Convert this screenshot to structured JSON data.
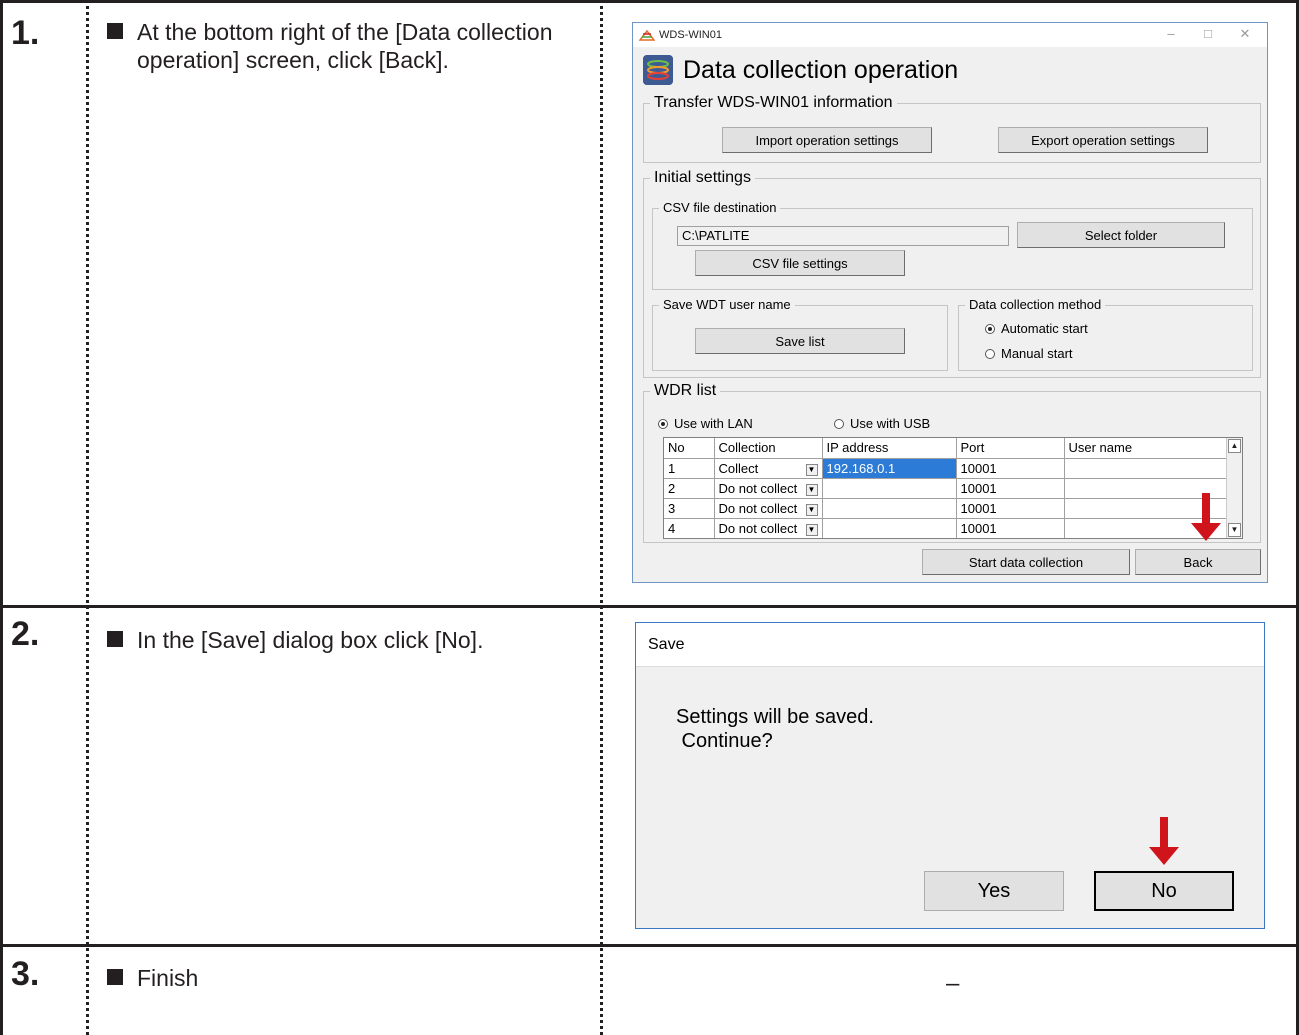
{
  "steps": [
    {
      "number": "1.",
      "text": "At the bottom right of the [Data collection operation] screen, click [Back]."
    },
    {
      "number": "2.",
      "text": "In the [Save] dialog box click [No]."
    },
    {
      "number": "3.",
      "text": "Finish"
    }
  ],
  "step3_result": "–",
  "app_window": {
    "window_title": "WDS-WIN01",
    "heading": "Data collection operation",
    "transfer_group": {
      "label": "Transfer WDS-WIN01 information",
      "import_label": "Import operation settings",
      "export_label": "Export operation settings"
    },
    "initial_group": {
      "label": "Initial settings",
      "csv_group_label": "CSV file destination",
      "csv_path": "C:\\PATLITE",
      "select_folder_label": "Select folder",
      "csv_settings_label": "CSV file settings",
      "save_user_group_label": "Save WDT user name",
      "save_list_label": "Save list",
      "method_group_label": "Data collection method",
      "method_options": [
        {
          "label": "Automatic start",
          "selected": true
        },
        {
          "label": "Manual start",
          "selected": false
        }
      ]
    },
    "wdr_group": {
      "label": "WDR list",
      "interface_options": [
        {
          "label": "Use with LAN",
          "selected": true
        },
        {
          "label": "Use with USB",
          "selected": false
        }
      ],
      "columns": [
        "No",
        "Collection",
        "IP address",
        "Port",
        "User name"
      ],
      "rows": [
        [
          "1",
          "Collect",
          "192.168.0.1",
          "10001",
          ""
        ],
        [
          "2",
          "Do not collect",
          "",
          "10001",
          ""
        ],
        [
          "3",
          "Do not collect",
          "",
          "10001",
          ""
        ],
        [
          "4",
          "Do not collect",
          "",
          "10001",
          ""
        ]
      ]
    },
    "start_label": "Start data collection",
    "back_label": "Back"
  },
  "save_dialog": {
    "title": "Save",
    "message": "Settings will be saved.\n Continue?",
    "yes_label": "Yes",
    "no_label": "No"
  },
  "colors": {
    "arrow": "#d0141c",
    "selection": "#2c7bd6",
    "window_border": "#6f94c8"
  },
  "icons": [
    "app-icon",
    "data-collection-icon",
    "down-arrow-icon"
  ]
}
